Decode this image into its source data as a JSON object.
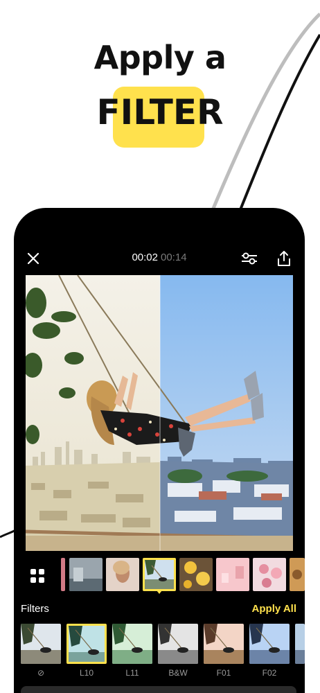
{
  "headline": {
    "line1": "Apply a",
    "line2": "FILTER"
  },
  "colors": {
    "accent": "#FFE14D",
    "phone_bg": "#000000"
  },
  "player": {
    "close_icon": "close-icon",
    "current_time": "00:02",
    "total_time": "00:14",
    "adjust_icon": "sliders-icon",
    "share_icon": "share-icon"
  },
  "strip": {
    "layout_icon": "grid-icon",
    "selected_index": 3
  },
  "filters": {
    "title": "Filters",
    "apply_all": "Apply All",
    "items": [
      {
        "label": "⊘",
        "tint": "none"
      },
      {
        "label": "L10",
        "tint": "teal",
        "selected": true
      },
      {
        "label": "L11",
        "tint": "green"
      },
      {
        "label": "B&W",
        "tint": "mono"
      },
      {
        "label": "F01",
        "tint": "warm"
      },
      {
        "label": "F02",
        "tint": "cool"
      }
    ]
  }
}
